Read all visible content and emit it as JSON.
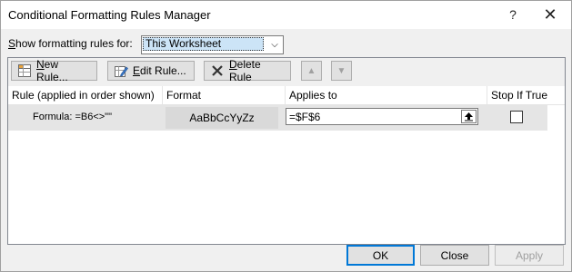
{
  "window": {
    "title": "Conditional Formatting Rules Manager",
    "help_label": "?",
    "close_label": "✕"
  },
  "show_rules": {
    "label_prefix": "S",
    "label_rest": "how formatting rules for:",
    "selected": "This Worksheet",
    "arrow": "⌵"
  },
  "toolbar": {
    "new_rule_u": "N",
    "new_rule_rest": "ew Rule...",
    "edit_rule_u": "E",
    "edit_rule_rest": "dit Rule...",
    "delete_rule_u": "D",
    "delete_rule_rest": "elete Rule",
    "move_up": "▲",
    "move_down": "▼"
  },
  "table": {
    "headers": [
      "Rule (applied in order shown)",
      "Format",
      "Applies to",
      "Stop If True"
    ],
    "rows": [
      {
        "rule": "Formula: =B6<>\"\"",
        "format_preview": "AaBbCcYyZz",
        "applies_to": "=$F$6",
        "stop_if_true": false
      }
    ]
  },
  "buttons": {
    "ok": "OK",
    "close": "Close",
    "apply": "Apply"
  },
  "colors": {
    "selected_value_bg": "#cce4f7",
    "row_bg": "#e5e5e5",
    "default_button_border": "#0078d7"
  }
}
